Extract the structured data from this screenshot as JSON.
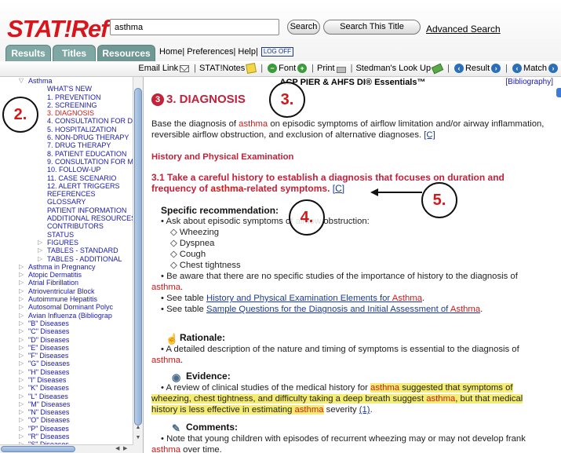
{
  "app": {
    "logo_text": "STAT!Ref",
    "search_value": "asthma",
    "search_button": "Search",
    "search_title_button": "Search This Title",
    "advanced_search": "Advanced Search"
  },
  "tabs": [
    "Results",
    "Titles",
    "Resources"
  ],
  "topnav": {
    "home": "Home|",
    "preferences": "Preferences|",
    "help": "Help|",
    "logoff": "LOG OFF"
  },
  "toolbar": {
    "email_link": "Email Link",
    "statnotes": "STAT!Notes",
    "font": "Font",
    "print": "Print",
    "stedmans": "Stedman's Look Up",
    "result": "Result",
    "match": "Match"
  },
  "sidebar": {
    "items": [
      {
        "label": "Asthma",
        "indent": 0,
        "color": "blue",
        "arrow": "down"
      },
      {
        "label": "WHAT'S NEW",
        "indent": 1,
        "color": "blue"
      },
      {
        "label": "1. PREVENTION",
        "indent": 1,
        "color": "blue"
      },
      {
        "label": "2. SCREENING",
        "indent": 1,
        "color": "blue"
      },
      {
        "label": "3. DIAGNOSIS",
        "indent": 1,
        "color": "red"
      },
      {
        "label": "4. CONSULTATION FOR D",
        "indent": 1,
        "color": "blue"
      },
      {
        "label": "5. HOSPITALIZATION",
        "indent": 1,
        "color": "blue"
      },
      {
        "label": "6. NON-DRUG THERAPY",
        "indent": 1,
        "color": "blue"
      },
      {
        "label": "7. DRUG THERAPY",
        "indent": 1,
        "color": "blue"
      },
      {
        "label": "8. PATIENT EDUCATION",
        "indent": 1,
        "color": "blue"
      },
      {
        "label": "9. CONSULTATION FOR M",
        "indent": 1,
        "color": "blue"
      },
      {
        "label": "10. FOLLOW-UP",
        "indent": 1,
        "color": "blue"
      },
      {
        "label": "11. CASE SCENARIO",
        "indent": 1,
        "color": "blue"
      },
      {
        "label": "12. ALERT TRIGGERS",
        "indent": 1,
        "color": "blue"
      },
      {
        "label": "REFERENCES",
        "indent": 1,
        "color": "blue"
      },
      {
        "label": "GLOSSARY",
        "indent": 1,
        "color": "blue"
      },
      {
        "label": "PATIENT INFORMATION",
        "indent": 1,
        "color": "blue"
      },
      {
        "label": "ADDITIONAL RESOURCES",
        "indent": 1,
        "color": "blue"
      },
      {
        "label": "CONTRIBUTORS",
        "indent": 1,
        "color": "blue"
      },
      {
        "label": "STATUS",
        "indent": 1,
        "color": "blue"
      },
      {
        "label": "FIGURES",
        "indent": 2,
        "color": "blue",
        "arrow": "right"
      },
      {
        "label": "TABLES - STANDARD",
        "indent": 2,
        "color": "blue",
        "arrow": "right"
      },
      {
        "label": "TABLES - ADDITIONAL",
        "indent": 2,
        "color": "blue",
        "arrow": "right"
      },
      {
        "label": "Asthma in Pregnancy",
        "indent": 0,
        "color": "blue",
        "arrow": "right"
      },
      {
        "label": "Atopic Dermatitis",
        "indent": 0,
        "color": "blue",
        "arrow": "right"
      },
      {
        "label": "Atrial Fibrillation",
        "indent": 0,
        "color": "blue",
        "arrow": "right"
      },
      {
        "label": "Atrioventricular Block",
        "indent": 0,
        "color": "blue",
        "arrow": "right"
      },
      {
        "label": "Autoimmune Hepatitis",
        "indent": 0,
        "color": "blue",
        "arrow": "right"
      },
      {
        "label": "Autosomal Dominant Polyc",
        "indent": 0,
        "color": "blue",
        "arrow": "right"
      },
      {
        "label": "Avian Influenza (Bibliograp",
        "indent": 0,
        "color": "blue",
        "arrow": "right"
      },
      {
        "label": "\"B\" Diseases",
        "indent": 0,
        "color": "blue",
        "arrow": "right"
      },
      {
        "label": "\"C\" Diseases",
        "indent": 0,
        "color": "blue",
        "arrow": "right"
      },
      {
        "label": "\"D\" Diseases",
        "indent": 0,
        "color": "blue",
        "arrow": "right"
      },
      {
        "label": "\"E\" Diseases",
        "indent": 0,
        "color": "blue",
        "arrow": "right"
      },
      {
        "label": "\"F\" Diseases",
        "indent": 0,
        "color": "blue",
        "arrow": "right"
      },
      {
        "label": "\"G\" Diseases",
        "indent": 0,
        "color": "blue",
        "arrow": "right"
      },
      {
        "label": "\"H\" Diseases",
        "indent": 0,
        "color": "blue",
        "arrow": "right"
      },
      {
        "label": "\"I\" Diseases",
        "indent": 0,
        "color": "blue",
        "arrow": "right"
      },
      {
        "label": "\"K\" Diseases",
        "indent": 0,
        "color": "blue",
        "arrow": "right"
      },
      {
        "label": "\"L\" Diseases",
        "indent": 0,
        "color": "blue",
        "arrow": "right"
      },
      {
        "label": "\"M\" Diseases",
        "indent": 0,
        "color": "blue",
        "arrow": "right"
      },
      {
        "label": "\"N\" Diseases",
        "indent": 0,
        "color": "blue",
        "arrow": "right"
      },
      {
        "label": "\"O\" Diseases",
        "indent": 0,
        "color": "blue",
        "arrow": "right"
      },
      {
        "label": "\"P\" Diseases",
        "indent": 0,
        "color": "blue",
        "arrow": "right"
      },
      {
        "label": "\"R\" Diseases",
        "indent": 0,
        "color": "blue",
        "arrow": "right"
      },
      {
        "label": "\"S\" Diseases",
        "indent": 0,
        "color": "blue",
        "arrow": "right"
      }
    ]
  },
  "content": {
    "header_title": "ACP PIER & AHFS DI® Essentials™",
    "bibliography": "[Bibliography]",
    "section_number": "3",
    "section_title": "3. DIAGNOSIS",
    "intro_a": "Base the diagnosis of ",
    "intro_term": "asthma",
    "intro_b": " on episodic symptoms of airflow limitation and/or airway inflammation, reversible airflow obstruction, and exclusion of alternative diagnoses. ",
    "intro_ref": "[C]",
    "hpe_title": "History and Physical Examination",
    "s31_a": "3.1 Take a careful history to establish a diagnosis that focuses on duration and frequency of ",
    "s31_term": "asthma",
    "s31_b": "-related symptoms. ",
    "s31_ref": "[C]",
    "spec_title": "Specific recommendation:",
    "spec_bullet1": "• Ask about episodic symptoms of airflow obstruction:",
    "symptoms": [
      "◇ Wheezing",
      "◇ Dyspnea",
      "◇ Cough",
      "◇ Chest tightness"
    ],
    "aware_a": "• Be aware that there are no specific studies of the importance of history to the diagnosis of ",
    "aware_term": "asthma",
    "aware_b": ".",
    "see1_a": "• See table ",
    "see1_link_a": "History and Physical Examination Elements for ",
    "see1_link_term": "Asthma",
    "see1_b": ".",
    "see2_a": "• See table ",
    "see2_link_a": "Sample Questions for the Diagnosis and Initial Assessment of ",
    "see2_link_term": "Asthma",
    "see2_b": ".",
    "rationale_title": "Rationale:",
    "rationale_a": "• A detailed description of the nature and timing of symptoms is essential to the diagnosis of ",
    "rationale_term": "asthma",
    "rationale_b": ".",
    "evidence_title": "Evidence:",
    "evidence_a": "• A review of clinical studies of the medical history for ",
    "evidence_term1": "asthma",
    "evidence_b": " suggested that symptoms of wheezing, chest tightness, and difficulty taking a deep breath suggest ",
    "evidence_term2": "asthma",
    "evidence_c": ", but that medical history is less effective in estimating ",
    "evidence_term3": "asthma",
    "evidence_d": " severity ",
    "evidence_ref": "(1)",
    "evidence_e": ".",
    "comments_title": "Comments:",
    "comments_a": "• Note that young children with episodes of recurrent wheezing may or may not develop frank ",
    "comments_term": "asthma",
    "comments_b": " over time."
  },
  "annotations": [
    "2.",
    "3.",
    "4.",
    "5."
  ],
  "colors": {
    "brand_red": "#d21818",
    "section_red": "#c4213a",
    "tab_teal": "#7fa7a4",
    "link_blue": "#1a3a9a",
    "highlight_yellow": "#f5ec73"
  }
}
